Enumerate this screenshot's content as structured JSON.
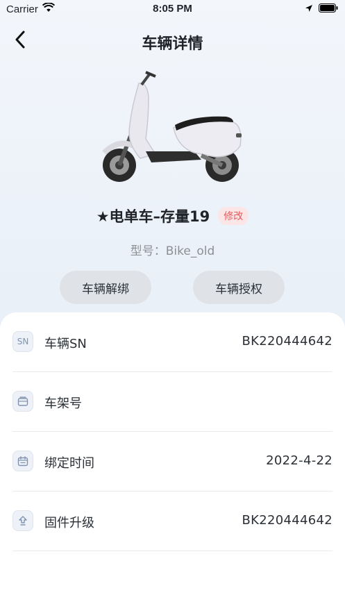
{
  "status_bar": {
    "carrier": "Carrier",
    "time": "8:05 PM"
  },
  "nav": {
    "title": "车辆详情",
    "back_icon": "chevron-left-icon"
  },
  "vehicle": {
    "name": "★电单车–存量19",
    "edit_label": "修改",
    "model_text": "型号：Bike_old",
    "image": "scooter-image"
  },
  "actions": {
    "unbind_label": "车辆解绑",
    "authorize_label": "车辆授权"
  },
  "details": [
    {
      "icon": "sn-icon",
      "icon_text": "SN",
      "label": "车辆SN",
      "value": "BK220444642"
    },
    {
      "icon": "frame-icon",
      "icon_text": "",
      "label": "车架号",
      "value": ""
    },
    {
      "icon": "calendar-icon",
      "icon_text": "",
      "label": "绑定时间",
      "value": "2022-4-22"
    },
    {
      "icon": "upgrade-icon",
      "icon_text": "",
      "label": "固件升级",
      "value": "BK220444642"
    }
  ],
  "colors": {
    "accent_red": "#e45b5b",
    "badge_bg": "#fbe5e6",
    "button_bg": "#dfe3e8"
  }
}
